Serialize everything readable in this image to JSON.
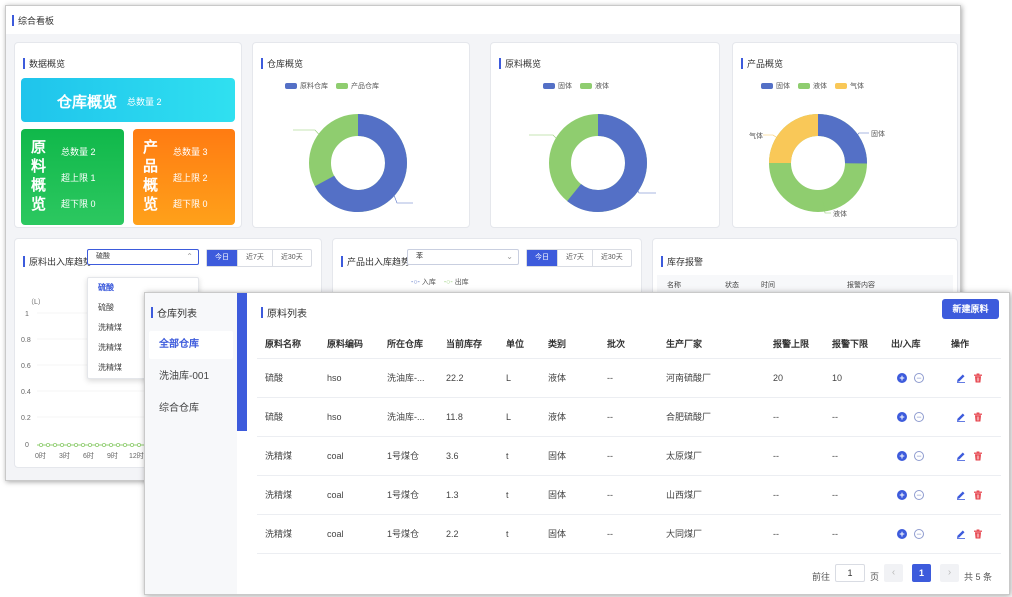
{
  "dashboard": {
    "title": "综合看板",
    "data_overview": {
      "title": "数据概览",
      "warehouse": {
        "title": "仓库概览",
        "total": "总数量 2"
      },
      "material": {
        "title": "原料概览",
        "total": "总数量 2",
        "upper": "超上限 1",
        "lower": "超下限 0"
      },
      "product": {
        "title": "产品概览",
        "total": "总数量 3",
        "upper": "超上限 2",
        "lower": "超下限 0"
      }
    },
    "warehouse_chart": {
      "title": "仓库概览",
      "legend": [
        "原料仓库",
        "产品仓库"
      ]
    },
    "material_chart": {
      "title": "原料概览",
      "legend": [
        "固体",
        "液体"
      ]
    },
    "product_chart": {
      "title": "产品概览",
      "legend": [
        "固体",
        "液体",
        "气体"
      ],
      "labels": [
        "气体",
        "固体",
        "液体"
      ]
    },
    "material_trend": {
      "title": "原料出入库趋势",
      "select_value": "硫酸",
      "ranges": [
        "今日",
        "近7天",
        "近30天"
      ],
      "dropdown": [
        "硫酸",
        "硫酸",
        "洗精煤",
        "洗精煤",
        "洗精煤"
      ],
      "yaxis_unit": "（L）",
      "yticks": [
        "1",
        "0.8",
        "0.6",
        "0.4",
        "0.2",
        "0"
      ],
      "xticks": [
        "0时",
        "3时",
        "6时",
        "9时",
        "12时"
      ]
    },
    "product_trend": {
      "title": "产品出入库趋势",
      "select_value": "苯",
      "ranges": [
        "今日",
        "近7天",
        "近30天"
      ],
      "legend": [
        "入库",
        "出库"
      ]
    },
    "alarm": {
      "title": "库存报警",
      "headers": [
        "名称",
        "状态",
        "时间",
        "报警内容"
      ]
    }
  },
  "inventory": {
    "sidebar_title": "仓库列表",
    "sidebar_items": [
      "全部仓库",
      "洗油库-001",
      "综合仓库"
    ],
    "list_title": "原料列表",
    "new_button": "新建原料",
    "headers": [
      "原料名称",
      "原料编码",
      "所在仓库",
      "当前库存",
      "单位",
      "类别",
      "批次",
      "生产厂家",
      "报警上限",
      "报警下限",
      "出/入库",
      "操作"
    ],
    "rows": [
      [
        "硫酸",
        "hso",
        "洗油库-...",
        "22.2",
        "L",
        "液体",
        "--",
        "河南硫酸厂",
        "20",
        "10"
      ],
      [
        "硫酸",
        "hso",
        "洗油库-...",
        "11.8",
        "L",
        "液体",
        "--",
        "合肥硫酸厂",
        "--",
        "--"
      ],
      [
        "洗精煤",
        "coal",
        "1号煤仓",
        "3.6",
        "t",
        "固体",
        "--",
        "太原煤厂",
        "--",
        "--"
      ],
      [
        "洗精煤",
        "coal",
        "1号煤仓",
        "1.3",
        "t",
        "固体",
        "--",
        "山西煤厂",
        "--",
        "--"
      ],
      [
        "洗精煤",
        "coal",
        "1号煤仓",
        "2.2",
        "t",
        "固体",
        "--",
        "大同煤厂",
        "--",
        "--"
      ]
    ],
    "pager": {
      "goto": "前往",
      "page_input": "1",
      "page_unit": "页",
      "current": "1",
      "total": "共 5 条"
    }
  },
  "colors": {
    "accent": "#3d5bdc",
    "green": "#8fcd6f",
    "blue": "#5470c6",
    "yellow": "#f9c858",
    "delete": "#e6414a"
  }
}
